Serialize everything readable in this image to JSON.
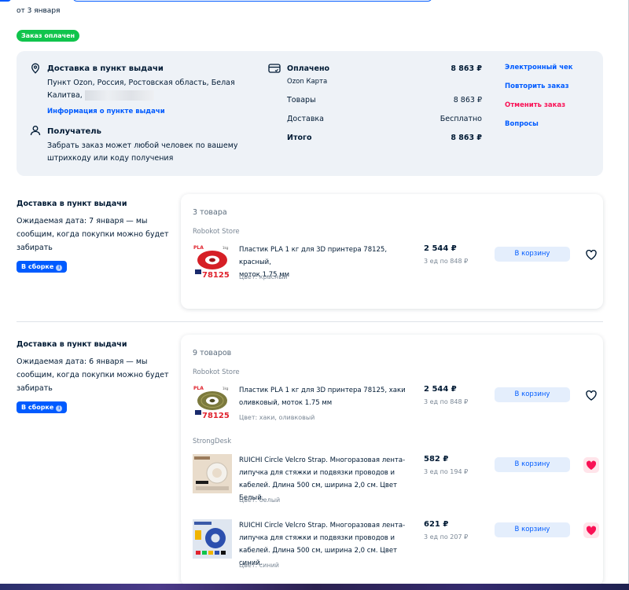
{
  "order": {
    "date_text": "от 3 января",
    "status_badge": "Заказ оплачен"
  },
  "summary": {
    "delivery_title": "Доставка в пункт выдачи",
    "delivery_address_line1": "Пункт Ozon, Россия, Ростовская область, Белая",
    "delivery_address_line2": "Калитва,",
    "delivery_info_link": "Информация о пункте выдачи",
    "recipient_title": "Получатель",
    "recipient_text_line1": "Забрать заказ может любой человек по вашему",
    "recipient_text_line2": "штрихкоду или коду получения",
    "payment": {
      "status": "Оплачено",
      "amount": "8 863 ₽",
      "method": "Ozon Карта",
      "goods_label": "Товары",
      "goods_value": "8 863 ₽",
      "delivery_label": "Доставка",
      "delivery_value": "Бесплатно",
      "total_label": "Итого",
      "total_value": "8 863 ₽"
    },
    "actions": {
      "receipt": "Электронный чек",
      "repeat": "Повторить заказ",
      "cancel": "Отменить заказ",
      "questions": "Вопросы"
    }
  },
  "shipments": [
    {
      "title": "Доставка в пункт выдачи",
      "text_line1": "Ожидаемая дата: 7 января — мы",
      "text_line2": "сообщим, когда покупки можно будет",
      "text_line3": "забирать",
      "badge": "В сборке",
      "count": "3 товара",
      "store": "Robokot Store",
      "item": {
        "title_line1": "Пластик PLA 1 кг для 3D принтера 78125, красный,",
        "title_line2": "моток 1.75 мм",
        "color": "Цвет: красный",
        "price": "2 544 ₽",
        "unit": "3 ед по 848 ₽",
        "cart": "В корзину",
        "thumb_label": "PLA",
        "thumb_weight": "1kg",
        "thumb_code": "78125"
      }
    },
    {
      "title": "Доставка в пункт выдачи",
      "text_line1": "Ожидаемая дата: 6 января — мы",
      "text_line2": "сообщим, когда покупки можно будет",
      "text_line3": "забирать",
      "badge": "В сборке",
      "count": "9 товаров",
      "store1": "Robokot Store",
      "store2": "StrongDesk",
      "item1": {
        "title_line1": "Пластик PLA 1 кг для 3D принтера 78125, хаки",
        "title_line2": "оливковый, моток 1.75 мм",
        "color": "Цвет: хаки, оливковый",
        "price": "2 544 ₽",
        "unit": "3 ед по 848 ₽",
        "cart": "В корзину",
        "thumb_label": "PLA",
        "thumb_weight": "1kg",
        "thumb_code": "78125"
      },
      "item2": {
        "title_line1": "RUICHI Circle Velcro Strap. Многоразовая лента-",
        "title_line2": "липучка для стяжки и подвязки проводов и",
        "title_line3": "кабелей. Длина 500 см, ширина 2,0 см. Цвет Белый.",
        "color": "Цвет: белый",
        "price": "582 ₽",
        "unit": "3 ед по 194 ₽",
        "cart": "В корзину"
      },
      "item3": {
        "title_line1": "RUICHI Circle Velcro Strap. Многоразовая лента-",
        "title_line2": "липучка для стяжки и подвязки проводов и",
        "title_line3": "кабелей. Длина 500 см, ширина 2,0 см. Цвет синий.",
        "color": "Цвет: синий",
        "price": "621 ₽",
        "unit": "3 ед по 207 ₽",
        "cart": "В корзину"
      }
    }
  ],
  "colors": {
    "accent": "#005bff",
    "success": "#10c44c",
    "danger": "#f91155",
    "panel": "#eef2f7"
  }
}
